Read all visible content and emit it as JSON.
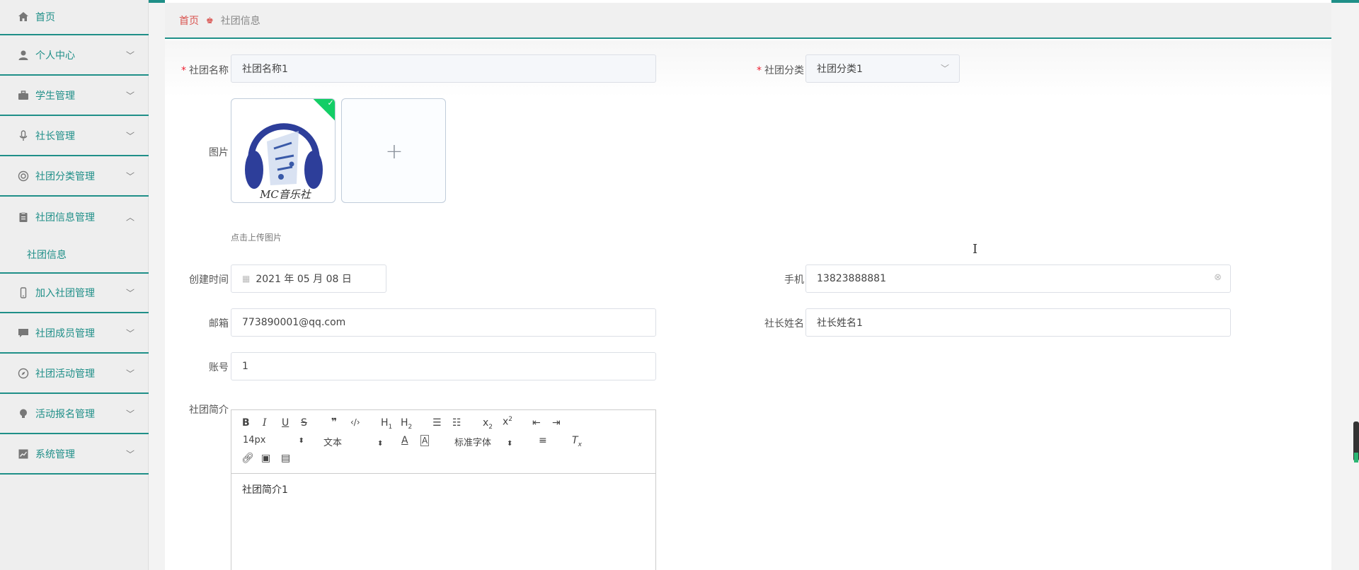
{
  "sidebar": {
    "items": [
      {
        "label": "首页",
        "icon": "home-icon"
      },
      {
        "label": "个人中心",
        "icon": "user-icon"
      },
      {
        "label": "学生管理",
        "icon": "briefcase-icon"
      },
      {
        "label": "社长管理",
        "icon": "microphone-icon"
      },
      {
        "label": "社团分类管理",
        "icon": "lifebuoy-icon"
      },
      {
        "label": "社团信息管理",
        "icon": "clipboard-icon"
      },
      {
        "label": "加入社团管理",
        "icon": "phone-icon"
      },
      {
        "label": "社团成员管理",
        "icon": "chat-icon"
      },
      {
        "label": "社团活动管理",
        "icon": "compass-icon"
      },
      {
        "label": "活动报名管理",
        "icon": "bulb-icon"
      },
      {
        "label": "系统管理",
        "icon": "chart-icon"
      }
    ],
    "subitem": "社团信息",
    "accent": "#1f8f88"
  },
  "breadcrumb": {
    "home": "首页",
    "current": "社团信息"
  },
  "form": {
    "name_label": "社团名称",
    "name_value": "社团名称1",
    "category_label": "社团分类",
    "category_value": "社团分类1",
    "image_label": "图片",
    "upload_hint": "点击上传图片",
    "logo_text": "MC音乐社",
    "created_label": "创建时间",
    "created_value": "2021 年 05 月 08 日",
    "phone_label": "手机",
    "phone_value": "13823888881",
    "email_label": "邮箱",
    "email_value": "773890001@qq.com",
    "president_label": "社长姓名",
    "president_value": "社长姓名1",
    "account_label": "账号",
    "account_value": "1",
    "intro_label": "社团简介"
  },
  "editor": {
    "font_size": "14px",
    "block_type": "文本",
    "font_family": "标准字体",
    "content": "社团简介1"
  }
}
